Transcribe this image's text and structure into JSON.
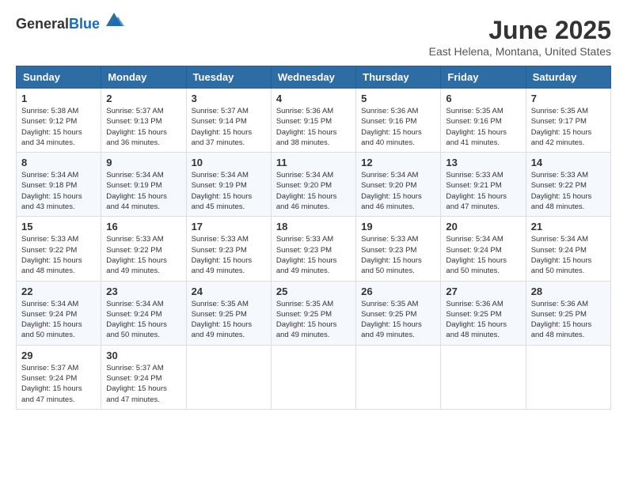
{
  "header": {
    "logo_general": "General",
    "logo_blue": "Blue",
    "title": "June 2025",
    "subtitle": "East Helena, Montana, United States"
  },
  "calendar": {
    "columns": [
      "Sunday",
      "Monday",
      "Tuesday",
      "Wednesday",
      "Thursday",
      "Friday",
      "Saturday"
    ],
    "weeks": [
      [
        {
          "day": "1",
          "info": "Sunrise: 5:38 AM\nSunset: 9:12 PM\nDaylight: 15 hours\nand 34 minutes."
        },
        {
          "day": "2",
          "info": "Sunrise: 5:37 AM\nSunset: 9:13 PM\nDaylight: 15 hours\nand 36 minutes."
        },
        {
          "day": "3",
          "info": "Sunrise: 5:37 AM\nSunset: 9:14 PM\nDaylight: 15 hours\nand 37 minutes."
        },
        {
          "day": "4",
          "info": "Sunrise: 5:36 AM\nSunset: 9:15 PM\nDaylight: 15 hours\nand 38 minutes."
        },
        {
          "day": "5",
          "info": "Sunrise: 5:36 AM\nSunset: 9:16 PM\nDaylight: 15 hours\nand 40 minutes."
        },
        {
          "day": "6",
          "info": "Sunrise: 5:35 AM\nSunset: 9:16 PM\nDaylight: 15 hours\nand 41 minutes."
        },
        {
          "day": "7",
          "info": "Sunrise: 5:35 AM\nSunset: 9:17 PM\nDaylight: 15 hours\nand 42 minutes."
        }
      ],
      [
        {
          "day": "8",
          "info": "Sunrise: 5:34 AM\nSunset: 9:18 PM\nDaylight: 15 hours\nand 43 minutes."
        },
        {
          "day": "9",
          "info": "Sunrise: 5:34 AM\nSunset: 9:19 PM\nDaylight: 15 hours\nand 44 minutes."
        },
        {
          "day": "10",
          "info": "Sunrise: 5:34 AM\nSunset: 9:19 PM\nDaylight: 15 hours\nand 45 minutes."
        },
        {
          "day": "11",
          "info": "Sunrise: 5:34 AM\nSunset: 9:20 PM\nDaylight: 15 hours\nand 46 minutes."
        },
        {
          "day": "12",
          "info": "Sunrise: 5:34 AM\nSunset: 9:20 PM\nDaylight: 15 hours\nand 46 minutes."
        },
        {
          "day": "13",
          "info": "Sunrise: 5:33 AM\nSunset: 9:21 PM\nDaylight: 15 hours\nand 47 minutes."
        },
        {
          "day": "14",
          "info": "Sunrise: 5:33 AM\nSunset: 9:22 PM\nDaylight: 15 hours\nand 48 minutes."
        }
      ],
      [
        {
          "day": "15",
          "info": "Sunrise: 5:33 AM\nSunset: 9:22 PM\nDaylight: 15 hours\nand 48 minutes."
        },
        {
          "day": "16",
          "info": "Sunrise: 5:33 AM\nSunset: 9:22 PM\nDaylight: 15 hours\nand 49 minutes."
        },
        {
          "day": "17",
          "info": "Sunrise: 5:33 AM\nSunset: 9:23 PM\nDaylight: 15 hours\nand 49 minutes."
        },
        {
          "day": "18",
          "info": "Sunrise: 5:33 AM\nSunset: 9:23 PM\nDaylight: 15 hours\nand 49 minutes."
        },
        {
          "day": "19",
          "info": "Sunrise: 5:33 AM\nSunset: 9:23 PM\nDaylight: 15 hours\nand 50 minutes."
        },
        {
          "day": "20",
          "info": "Sunrise: 5:34 AM\nSunset: 9:24 PM\nDaylight: 15 hours\nand 50 minutes."
        },
        {
          "day": "21",
          "info": "Sunrise: 5:34 AM\nSunset: 9:24 PM\nDaylight: 15 hours\nand 50 minutes."
        }
      ],
      [
        {
          "day": "22",
          "info": "Sunrise: 5:34 AM\nSunset: 9:24 PM\nDaylight: 15 hours\nand 50 minutes."
        },
        {
          "day": "23",
          "info": "Sunrise: 5:34 AM\nSunset: 9:24 PM\nDaylight: 15 hours\nand 50 minutes."
        },
        {
          "day": "24",
          "info": "Sunrise: 5:35 AM\nSunset: 9:25 PM\nDaylight: 15 hours\nand 49 minutes."
        },
        {
          "day": "25",
          "info": "Sunrise: 5:35 AM\nSunset: 9:25 PM\nDaylight: 15 hours\nand 49 minutes."
        },
        {
          "day": "26",
          "info": "Sunrise: 5:35 AM\nSunset: 9:25 PM\nDaylight: 15 hours\nand 49 minutes."
        },
        {
          "day": "27",
          "info": "Sunrise: 5:36 AM\nSunset: 9:25 PM\nDaylight: 15 hours\nand 48 minutes."
        },
        {
          "day": "28",
          "info": "Sunrise: 5:36 AM\nSunset: 9:25 PM\nDaylight: 15 hours\nand 48 minutes."
        }
      ],
      [
        {
          "day": "29",
          "info": "Sunrise: 5:37 AM\nSunset: 9:24 PM\nDaylight: 15 hours\nand 47 minutes."
        },
        {
          "day": "30",
          "info": "Sunrise: 5:37 AM\nSunset: 9:24 PM\nDaylight: 15 hours\nand 47 minutes."
        },
        {
          "day": "",
          "info": ""
        },
        {
          "day": "",
          "info": ""
        },
        {
          "day": "",
          "info": ""
        },
        {
          "day": "",
          "info": ""
        },
        {
          "day": "",
          "info": ""
        }
      ]
    ]
  }
}
